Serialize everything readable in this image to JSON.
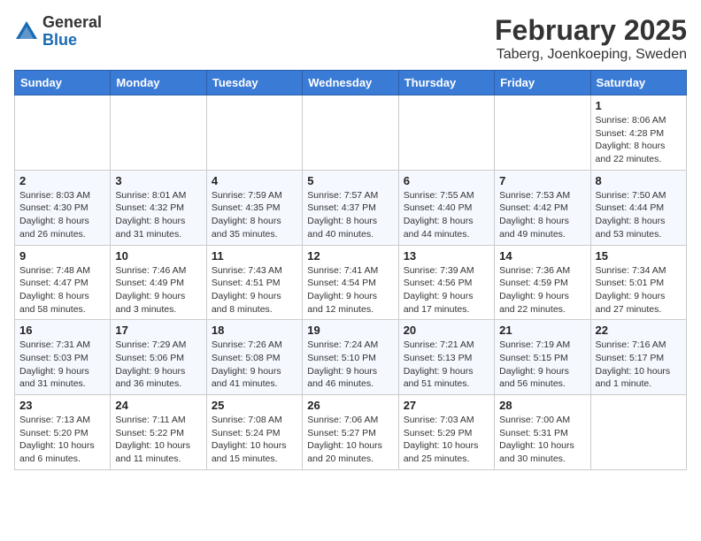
{
  "header": {
    "logo_general": "General",
    "logo_blue": "Blue",
    "month_title": "February 2025",
    "location": "Taberg, Joenkoeping, Sweden"
  },
  "weekdays": [
    "Sunday",
    "Monday",
    "Tuesday",
    "Wednesday",
    "Thursday",
    "Friday",
    "Saturday"
  ],
  "weeks": [
    [
      {
        "day": "",
        "info": ""
      },
      {
        "day": "",
        "info": ""
      },
      {
        "day": "",
        "info": ""
      },
      {
        "day": "",
        "info": ""
      },
      {
        "day": "",
        "info": ""
      },
      {
        "day": "",
        "info": ""
      },
      {
        "day": "1",
        "info": "Sunrise: 8:06 AM\nSunset: 4:28 PM\nDaylight: 8 hours and 22 minutes."
      }
    ],
    [
      {
        "day": "2",
        "info": "Sunrise: 8:03 AM\nSunset: 4:30 PM\nDaylight: 8 hours and 26 minutes."
      },
      {
        "day": "3",
        "info": "Sunrise: 8:01 AM\nSunset: 4:32 PM\nDaylight: 8 hours and 31 minutes."
      },
      {
        "day": "4",
        "info": "Sunrise: 7:59 AM\nSunset: 4:35 PM\nDaylight: 8 hours and 35 minutes."
      },
      {
        "day": "5",
        "info": "Sunrise: 7:57 AM\nSunset: 4:37 PM\nDaylight: 8 hours and 40 minutes."
      },
      {
        "day": "6",
        "info": "Sunrise: 7:55 AM\nSunset: 4:40 PM\nDaylight: 8 hours and 44 minutes."
      },
      {
        "day": "7",
        "info": "Sunrise: 7:53 AM\nSunset: 4:42 PM\nDaylight: 8 hours and 49 minutes."
      },
      {
        "day": "8",
        "info": "Sunrise: 7:50 AM\nSunset: 4:44 PM\nDaylight: 8 hours and 53 minutes."
      }
    ],
    [
      {
        "day": "9",
        "info": "Sunrise: 7:48 AM\nSunset: 4:47 PM\nDaylight: 8 hours and 58 minutes."
      },
      {
        "day": "10",
        "info": "Sunrise: 7:46 AM\nSunset: 4:49 PM\nDaylight: 9 hours and 3 minutes."
      },
      {
        "day": "11",
        "info": "Sunrise: 7:43 AM\nSunset: 4:51 PM\nDaylight: 9 hours and 8 minutes."
      },
      {
        "day": "12",
        "info": "Sunrise: 7:41 AM\nSunset: 4:54 PM\nDaylight: 9 hours and 12 minutes."
      },
      {
        "day": "13",
        "info": "Sunrise: 7:39 AM\nSunset: 4:56 PM\nDaylight: 9 hours and 17 minutes."
      },
      {
        "day": "14",
        "info": "Sunrise: 7:36 AM\nSunset: 4:59 PM\nDaylight: 9 hours and 22 minutes."
      },
      {
        "day": "15",
        "info": "Sunrise: 7:34 AM\nSunset: 5:01 PM\nDaylight: 9 hours and 27 minutes."
      }
    ],
    [
      {
        "day": "16",
        "info": "Sunrise: 7:31 AM\nSunset: 5:03 PM\nDaylight: 9 hours and 31 minutes."
      },
      {
        "day": "17",
        "info": "Sunrise: 7:29 AM\nSunset: 5:06 PM\nDaylight: 9 hours and 36 minutes."
      },
      {
        "day": "18",
        "info": "Sunrise: 7:26 AM\nSunset: 5:08 PM\nDaylight: 9 hours and 41 minutes."
      },
      {
        "day": "19",
        "info": "Sunrise: 7:24 AM\nSunset: 5:10 PM\nDaylight: 9 hours and 46 minutes."
      },
      {
        "day": "20",
        "info": "Sunrise: 7:21 AM\nSunset: 5:13 PM\nDaylight: 9 hours and 51 minutes."
      },
      {
        "day": "21",
        "info": "Sunrise: 7:19 AM\nSunset: 5:15 PM\nDaylight: 9 hours and 56 minutes."
      },
      {
        "day": "22",
        "info": "Sunrise: 7:16 AM\nSunset: 5:17 PM\nDaylight: 10 hours and 1 minute."
      }
    ],
    [
      {
        "day": "23",
        "info": "Sunrise: 7:13 AM\nSunset: 5:20 PM\nDaylight: 10 hours and 6 minutes."
      },
      {
        "day": "24",
        "info": "Sunrise: 7:11 AM\nSunset: 5:22 PM\nDaylight: 10 hours and 11 minutes."
      },
      {
        "day": "25",
        "info": "Sunrise: 7:08 AM\nSunset: 5:24 PM\nDaylight: 10 hours and 15 minutes."
      },
      {
        "day": "26",
        "info": "Sunrise: 7:06 AM\nSunset: 5:27 PM\nDaylight: 10 hours and 20 minutes."
      },
      {
        "day": "27",
        "info": "Sunrise: 7:03 AM\nSunset: 5:29 PM\nDaylight: 10 hours and 25 minutes."
      },
      {
        "day": "28",
        "info": "Sunrise: 7:00 AM\nSunset: 5:31 PM\nDaylight: 10 hours and 30 minutes."
      },
      {
        "day": "",
        "info": ""
      }
    ]
  ]
}
